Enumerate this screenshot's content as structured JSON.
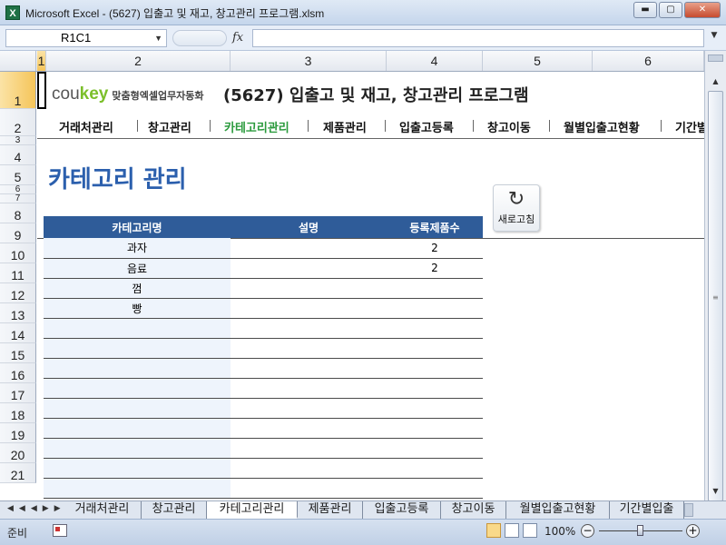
{
  "window": {
    "title": "Microsoft Excel - (5627) 입출고 및 재고, 창고관리 프로그램.xlsm",
    "app_icon": "excel-icon",
    "buttons": {
      "minimize": "▬",
      "maximize": "▢",
      "close": "✕"
    }
  },
  "formula_bar": {
    "name_box": "R1C1",
    "fx_label": "fx",
    "formula": ""
  },
  "columns": [
    {
      "label": "1",
      "selected": true
    },
    {
      "label": "2",
      "selected": false
    },
    {
      "label": "3",
      "selected": false
    },
    {
      "label": "4",
      "selected": false
    },
    {
      "label": "5",
      "selected": false
    },
    {
      "label": "6",
      "selected": false
    }
  ],
  "rows": [
    "1",
    "2",
    "3",
    "4",
    "5",
    "6",
    "7",
    "8",
    "9",
    "10",
    "11",
    "12",
    "13",
    "14",
    "15",
    "16",
    "17",
    "18",
    "19",
    "20",
    "21"
  ],
  "header": {
    "logo_cou": "cou",
    "logo_key": "key",
    "logo_sub": "맞춤형엑셀업무자동화",
    "title": "(5627) 입출고 및 재고, 창고관리 프로그램"
  },
  "nav": {
    "items": [
      "거래처관리",
      "창고관리",
      "카테고리관리",
      "제품관리",
      "입출고등록",
      "창고이동",
      "월별입출고현황",
      "기간별"
    ],
    "active_index": 2,
    "active_color": "#2a9a3c"
  },
  "section_title": "카테고리 관리",
  "refresh_button": {
    "label": "새로고침",
    "icon": "refresh-icon"
  },
  "table": {
    "headers": [
      "카테고리명",
      "설명",
      "등록제품수"
    ],
    "rows": [
      [
        "과자",
        "",
        "2"
      ],
      [
        "음료",
        "",
        "2"
      ],
      [
        "껌",
        "",
        ""
      ],
      [
        "빵",
        "",
        ""
      ],
      [
        "",
        "",
        ""
      ],
      [
        "",
        "",
        ""
      ],
      [
        "",
        "",
        ""
      ],
      [
        "",
        "",
        ""
      ],
      [
        "",
        "",
        ""
      ],
      [
        "",
        "",
        ""
      ],
      [
        "",
        "",
        ""
      ],
      [
        "",
        "",
        ""
      ],
      [
        "",
        "",
        ""
      ]
    ],
    "header_color": "#2f5c99"
  },
  "sheet_tabs": {
    "tabs": [
      "거래처관리",
      "창고관리",
      "카테고리관리",
      "제품관리",
      "입출고등록",
      "창고이동",
      "월별입출고현황",
      "기간별입출"
    ],
    "active_index": 2
  },
  "status_bar": {
    "mode": "준비",
    "zoom": "100%",
    "zoom_fraction": 0.5
  }
}
